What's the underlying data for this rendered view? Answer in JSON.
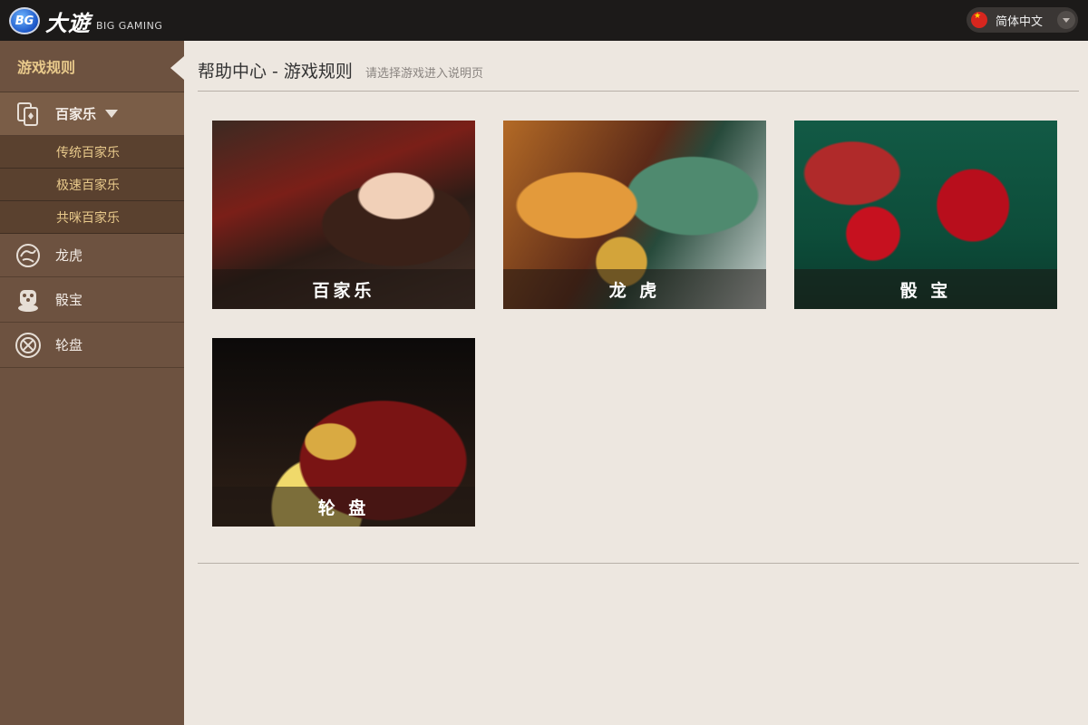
{
  "header": {
    "logo_badge": "BG",
    "logo_cn": "大遊",
    "logo_en": "BIG GAMING",
    "language": {
      "label": "简体中文",
      "flag": "china-flag-icon"
    }
  },
  "sidebar": {
    "heading": "游戏规则",
    "items": [
      {
        "label": "百家乐",
        "icon": "cards-icon",
        "expanded": true,
        "sub": [
          "传统百家乐",
          "极速百家乐",
          "共咪百家乐"
        ]
      },
      {
        "label": "龙虎",
        "icon": "dragon-icon"
      },
      {
        "label": "骰宝",
        "icon": "dice-icon"
      },
      {
        "label": "轮盘",
        "icon": "roulette-icon"
      }
    ]
  },
  "main": {
    "title": "帮助中心 - 游戏规则",
    "subtitle": "请选择游戏进入说明页",
    "games": [
      {
        "label": "百家乐"
      },
      {
        "label": "龙 虎"
      },
      {
        "label": "骰 宝"
      },
      {
        "label": "轮 盘"
      }
    ]
  },
  "colors": {
    "sidebar": "#6d5240",
    "accent": "#e8c98b",
    "topbar": "#1c1a19",
    "content_bg": "#ede7e0"
  }
}
